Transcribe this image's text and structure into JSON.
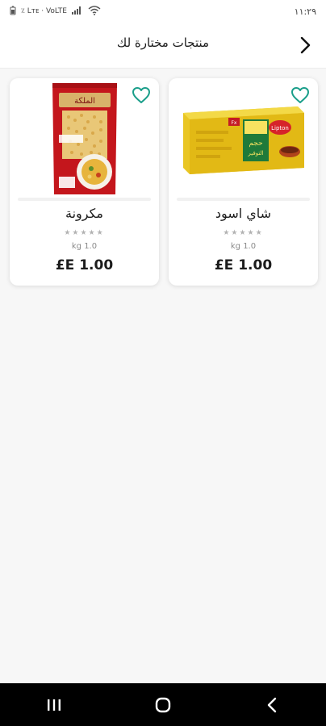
{
  "status_bar": {
    "time": "١١:٢٩",
    "left_text": "٪ Lᴛᴇ ⋅ VoLTE",
    "icons": [
      "battery-icon",
      "signal-icon",
      "wifi-icon"
    ]
  },
  "header": {
    "title": "منتجات مختارة لك",
    "back_icon": "chevron-right-icon"
  },
  "products": [
    {
      "name": "شاي اسود",
      "rating": "★★★★★",
      "unit": "kg 1.0",
      "price": "£E 1.00",
      "image": "tea-box-image"
    },
    {
      "name": "مكرونة",
      "rating": "★★★★★",
      "unit": "kg 1.0",
      "price": "£E 1.00",
      "image": "pasta-bag-image"
    }
  ],
  "colors": {
    "accent": "#1a9e8a",
    "background": "#f7f7f7",
    "card": "#ffffff"
  },
  "nav": {
    "icons": [
      "recents-icon",
      "home-icon",
      "back-icon"
    ]
  }
}
